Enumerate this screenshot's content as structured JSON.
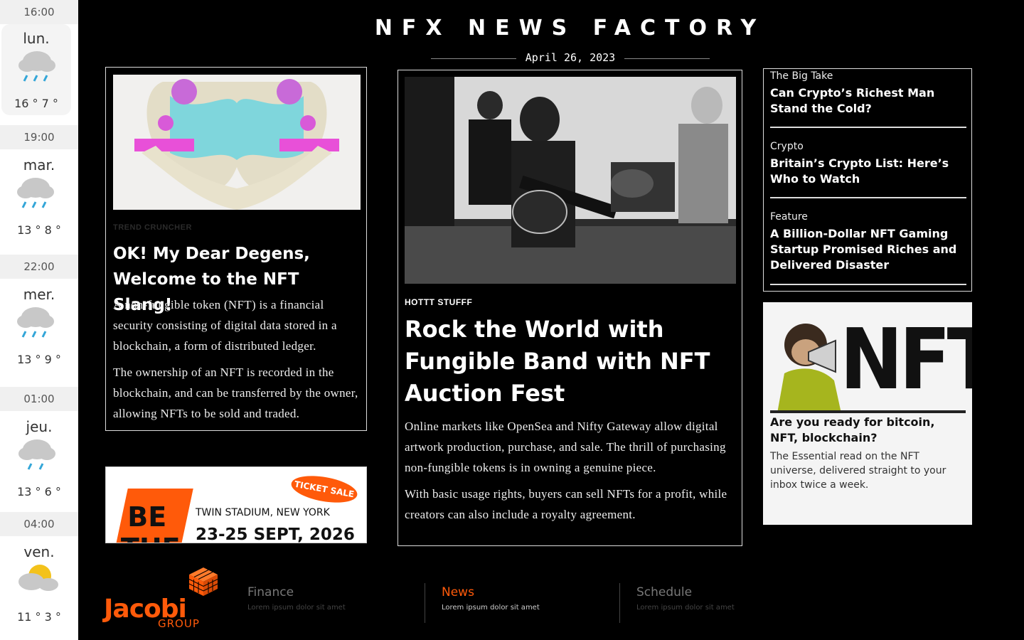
{
  "weather": [
    {
      "time": "16:00",
      "day": "lun.",
      "temps": "16 ° 7 °",
      "icon": "rain-cloud-icon"
    },
    {
      "time": "19:00",
      "day": "mar.",
      "temps": "13 ° 8 °",
      "icon": "rain-cloud-icon"
    },
    {
      "time": "22:00",
      "day": "mer.",
      "temps": "13 ° 9 °",
      "icon": "rain-cloud-icon"
    },
    {
      "time": "01:00",
      "day": "jeu.",
      "temps": "13 ° 6 °",
      "icon": "rain-cloud-icon"
    },
    {
      "time": "04:00",
      "day": "ven.",
      "temps": "11 ° 3 °",
      "icon": "partly-cloudy-icon"
    }
  ],
  "masthead": {
    "title": "NFX NEWS FACTORY",
    "date": "April 26, 2023"
  },
  "left_article": {
    "kicker": "TREND CRUNCHER",
    "title": "OK! My Dear Degens, Welcome to the NFT Slang!",
    "p1": "A non-fungible token (NFT) is a financial security consisting of digital data stored in a blockchain, a form of distributed ledger.",
    "p2": "The ownership of an NFT is recorded in the blockchain, and can be transferred by the owner, allowing NFTs to be sold and traded."
  },
  "ad": {
    "ticket": "TICKET SALE",
    "be": "BE",
    "the": "THE",
    "venue": "TWIN STADIUM, NEW YORK",
    "dates": "23-25 SEPT, 2026"
  },
  "main_article": {
    "kicker": "HOTTT STUFFF",
    "title": "Rock the World with Fungible Band with NFT Auction Fest",
    "p1": "Online markets like OpenSea and Nifty Gateway allow digital artwork production, purchase, and sale. The thrill of purchasing non-fungible tokens is in owning a genuine piece.",
    "p2": "With basic usage rights, buyers can sell NFTs for a profit, while creators can also include a royalty agreement."
  },
  "side_list": [
    {
      "category": "The Big Take",
      "headline": "Can Crypto’s Richest Man Stand the Cold?"
    },
    {
      "category": "Crypto",
      "headline": "Britain’s Crypto List: Here’s Who to Watch"
    },
    {
      "category": "Feature",
      "headline": "A Billion-Dollar NFT Gaming Startup Promised Riches and Delivered Disaster"
    }
  ],
  "promo": {
    "art_text": "NFT",
    "question": "Are you ready for bitcoin, NFT, blockchain?",
    "description": "The Essential read on the NFT universe, delivered straight to your inbox twice a week."
  },
  "footer": {
    "logo_word": "Jacobi",
    "logo_group": "GROUP",
    "nav": [
      {
        "label": "Finance",
        "sub": "Lorem ipsum dolor sit amet"
      },
      {
        "label": "News",
        "sub": "Lorem ipsum dolor sit amet"
      },
      {
        "label": "Schedule",
        "sub": "Lorem ipsum dolor sit amet"
      }
    ]
  },
  "colors": {
    "accent": "#ff5a0a",
    "background": "#000000",
    "card_border": "#dddddd"
  }
}
